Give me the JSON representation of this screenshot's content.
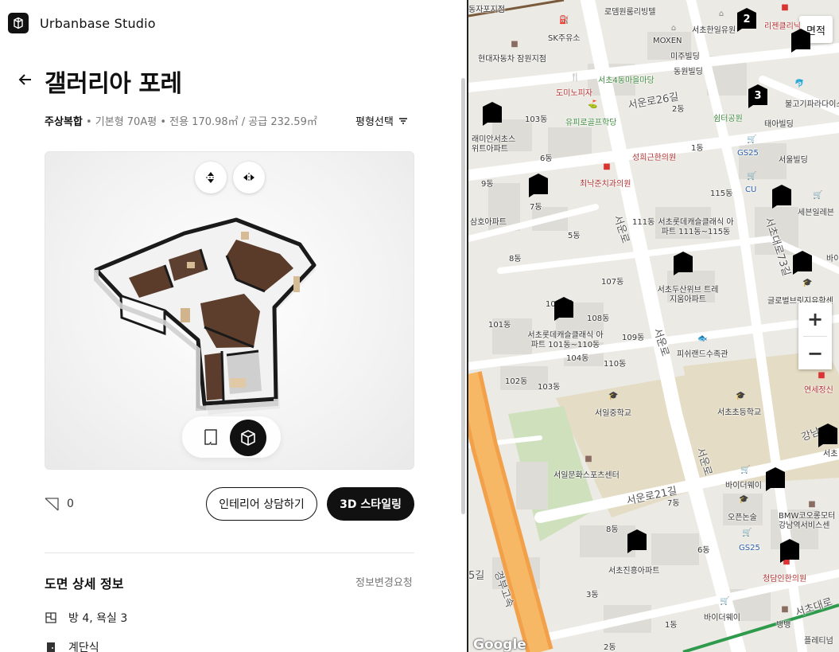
{
  "brand": {
    "name": "Urbanbase Studio"
  },
  "page": {
    "title": "갤러리아 포레",
    "meta_type": "주상복합",
    "meta_rest": " • 기본형 70A평 • 전용 170.98㎡ / 공급 232.59㎡",
    "size_select": "평형선택"
  },
  "actions": {
    "bookmark_count": "0",
    "consult": "인테리어 상담하기",
    "styling": "3D 스타일링"
  },
  "detail": {
    "title": "도면 상세 정보",
    "change_request": "정보변경요청",
    "rooms": "방 4, 욕실 3",
    "structure": "계단식"
  },
  "map": {
    "area_button": "면적",
    "zoom_in": "+",
    "zoom_out": "−",
    "attribution": "Google",
    "labels": {
      "l1": "로뎀원룸리빙텔",
      "l2": "서초한일유원",
      "l3": "리젠클리닉",
      "l4": "SK주유소",
      "l5": "MOXEN",
      "l6": "미주빌딩",
      "l7": "현대자동차 잠원지점",
      "l8": "동원빌딩",
      "l9": "서초4동마을마당",
      "l10": "도미노피자",
      "l11": "서운로26길",
      "l12": "불고기파라다이스",
      "l13": "103동",
      "l14": "2동",
      "l15": "쉼터공원",
      "l16": "태아빌딩",
      "l17": "유피로골프학당",
      "l18": "래미안서초스위트아파트",
      "l19": "성희근한의원",
      "l20": "1동",
      "l21": "GS25",
      "l22": "6동",
      "l23": "서울빌딩",
      "l24": "9동",
      "l25": "최낙준치과의원",
      "l26": "115동",
      "l27": "CU",
      "l28": "세븐일레븐",
      "l29": "7동",
      "l30": "삼호아파트",
      "l31": "111동",
      "l32": "서초롯데캐슬클래식 아파트 111동~115동",
      "l33": "5동",
      "l34": "서초대로73길",
      "l35": "8동",
      "l36": "107동",
      "l37": "서초두산위브 트레지움아파트",
      "l38": "글로벌브릿지유학센",
      "l39": "108동",
      "l40": "101동",
      "l41": "109동",
      "l42": "서초롯데캐슬클래식 아파트 101동~110동",
      "l43": "104동",
      "l44": "피쉬랜드수족관",
      "l45": "110동",
      "l46": "102동",
      "l47": "103동",
      "l48": "연세정신",
      "l49": "서일중학교",
      "l50": "서초초등학교",
      "l51": "서운로",
      "l52": "강남",
      "l53": "서일문화스포츠센터",
      "l54": "바이더웨이",
      "l55": "서운로21길",
      "l56": "7동",
      "l57": "오픈논술",
      "l58": "BMW코오롱모터 강남역서비스센",
      "l59": "8동",
      "l60": "6동",
      "l61": "GS25",
      "l62": "서초진흥아파트",
      "l63": "청담인한의원",
      "l64": "3동",
      "l65": "바이더웨이",
      "l66": "1동",
      "l67": "뱅뱅",
      "l68": "플레티넘",
      "l69": "서초대로",
      "l70": "경부고속",
      "l71": "2동",
      "l72": "서운로",
      "l73": "서운로",
      "l74": "동자포지점",
      "l75": "바이",
      "l76": "1003동",
      "l77": "5길",
      "l78": "서초"
    },
    "cluster_2": "2",
    "cluster_3": "3"
  }
}
